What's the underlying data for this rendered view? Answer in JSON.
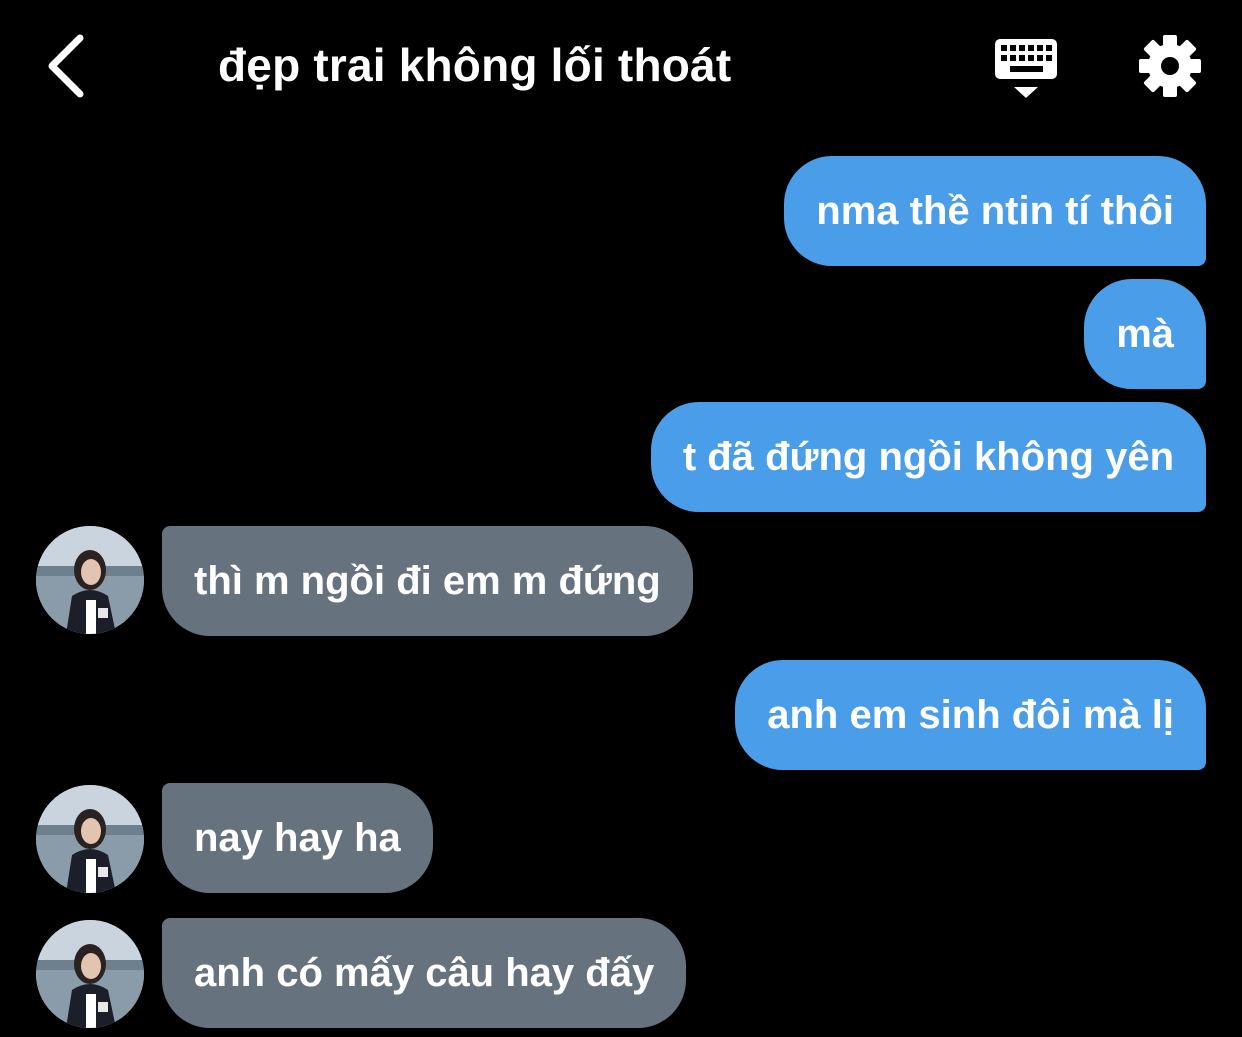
{
  "header": {
    "title": "đẹp trai không lối thoát",
    "back_icon": "chevron-left-icon",
    "keyboard_icon": "keyboard-icon",
    "settings_icon": "gear-icon"
  },
  "colors": {
    "background": "#000000",
    "sent_bubble": "#4a9de8",
    "received_bubble": "#66737f",
    "text": "#ffffff"
  },
  "messages": [
    {
      "direction": "sent",
      "text": "nma thề ntin tí thôi"
    },
    {
      "direction": "sent",
      "text": "mà"
    },
    {
      "direction": "sent",
      "text": "t đã đứng ngồi không yên"
    },
    {
      "direction": "received",
      "text": "thì m ngồi đi em m đứng"
    },
    {
      "direction": "sent",
      "text": "anh em sinh đôi mà lị"
    },
    {
      "direction": "received",
      "text": "nay hay ha"
    },
    {
      "direction": "received",
      "text": "anh có mấy câu hay đấy"
    }
  ]
}
